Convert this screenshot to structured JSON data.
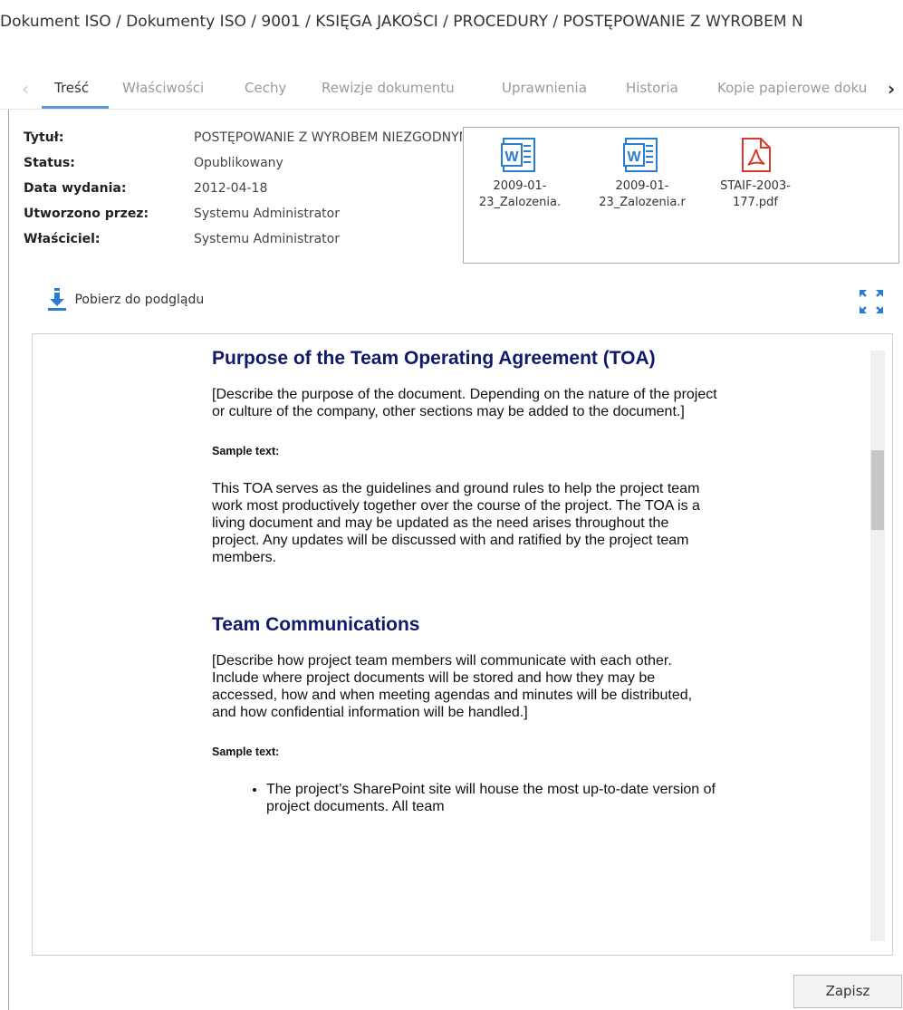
{
  "breadcrumb": "Dokument ISO / Dokumenty ISO / 9001 / KSIĘGA JAKOŚCI / PROCEDURY / POSTĘPOWANIE Z WYROBEM N",
  "tabs": [
    {
      "label": "Treść",
      "active": true
    },
    {
      "label": "Właściwości"
    },
    {
      "label": "Cechy"
    },
    {
      "label": "Rewizje dokumentu"
    },
    {
      "label": "Uprawnienia"
    },
    {
      "label": "Historia"
    },
    {
      "label": "Kopie papierowe doku"
    }
  ],
  "properties": [
    {
      "label": "Tytuł:",
      "value": "POSTĘPOWANIE Z WYROBEM NIEZGODNYM"
    },
    {
      "label": "Status:",
      "value": "Opublikowany"
    },
    {
      "label": "Data wydania:",
      "value": "2012-04-18"
    },
    {
      "label": "Utworzono przez:",
      "value": "Systemu Administrator"
    },
    {
      "label": "Właściciel:",
      "value": "Systemu Administrator"
    }
  ],
  "attachments": [
    {
      "icon": "word-icon",
      "line1": "2009-01-",
      "line2": "23_Zalozenia."
    },
    {
      "icon": "word-icon",
      "line1": "2009-01-",
      "line2": "23_Zalozenia.r"
    },
    {
      "icon": "pdf-icon",
      "line1": "STAIF-2003-",
      "line2": "177.pdf"
    }
  ],
  "download_label": "Pobierz do podglądu",
  "document": {
    "heading1": "Purpose of the Team Operating Agreement (TOA)",
    "para1": "[Describe the purpose of the document. Depending on the nature of the project or culture of the company, other sections may be added to the document.]",
    "sample1": "Sample text:",
    "para2": "This TOA serves as the guidelines and ground rules to help the project team work most productively together over the course of the project. The TOA is a living document and may be updated as the need arises throughout the project. Any updates will be discussed with and ratified by the project team members.",
    "heading2": "Team Communications",
    "para3": "[Describe how project team members will communicate with each other. Include where project documents will be stored and how they may be accessed, how and when meeting agendas and minutes will be distributed, and how confidential information will be handled.]",
    "sample2": "Sample text:",
    "bullet1": "The project’s SharePoint site will house the most up-to-date version of project documents. All team"
  },
  "save_label": "Zapisz",
  "colors": {
    "accent": "#5a9bd5",
    "heading": "#0f1a6b",
    "word": "#2b7cd3",
    "pdf": "#d9392c"
  }
}
